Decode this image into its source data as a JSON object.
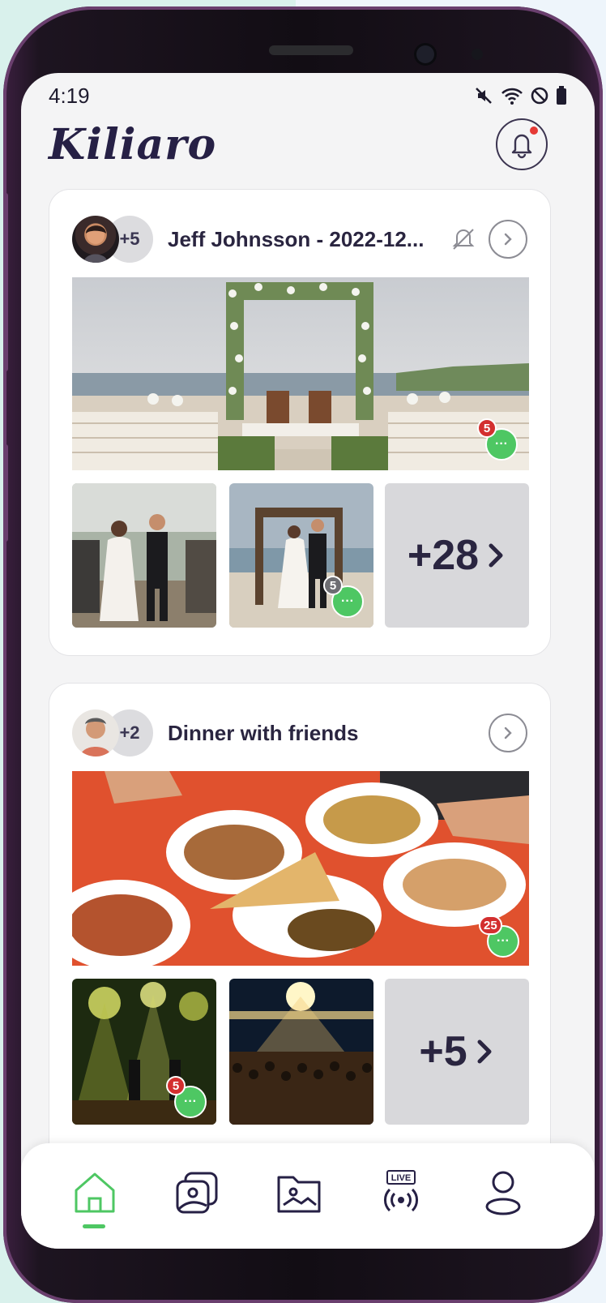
{
  "status_bar": {
    "time": "4:19"
  },
  "app": {
    "logo_text": "Kiliaro",
    "accent_color": "#4ec763",
    "brand_color": "#262045",
    "notification_dot_color": "#e53935"
  },
  "feed": [
    {
      "members_extra": "+5",
      "title": "Jeff Johnsson - 2022-12...",
      "muted": true,
      "main_photo_comments": "5",
      "thumbs": [
        {
          "comments": null
        },
        {
          "comments": "5"
        }
      ],
      "more_label": "+28"
    },
    {
      "members_extra": "+2",
      "title": "Dinner with friends",
      "muted": false,
      "main_photo_comments": "25",
      "thumbs": [
        {
          "comments": "5"
        },
        {
          "comments": null
        }
      ],
      "more_label": "+5"
    }
  ],
  "tabbar": {
    "items": [
      {
        "icon": "home-icon",
        "active": true
      },
      {
        "icon": "photos-icon",
        "active": false
      },
      {
        "icon": "album-folder-icon",
        "active": false
      },
      {
        "icon": "live-icon",
        "active": false,
        "badge": "LIVE"
      },
      {
        "icon": "profile-icon",
        "active": false
      }
    ]
  }
}
